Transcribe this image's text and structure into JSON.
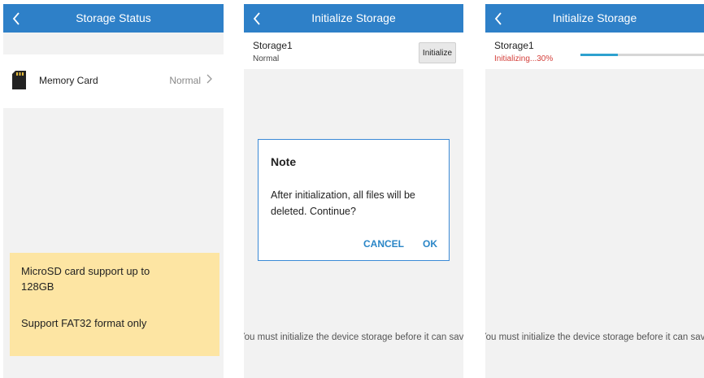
{
  "screen1": {
    "title": "Storage Status",
    "memory_card": {
      "label": "Memory Card",
      "status": "Normal"
    },
    "note": {
      "line1": "MicroSD card support up to 128GB",
      "line2": "Support FAT32 format only"
    }
  },
  "screen2": {
    "title": "Initialize Storage",
    "storage": {
      "name": "Storage1",
      "status": "Normal"
    },
    "initialize_label": "Initialize",
    "dialog": {
      "title": "Note",
      "body": "After initialization, all files will be deleted. Continue?",
      "cancel_label": "CANCEL",
      "ok_label": "OK"
    },
    "footer": "You must initialize the device storage before it can save videos."
  },
  "screen3": {
    "title": "Initialize Storage",
    "storage": {
      "name": "Storage1",
      "status": "Initializing...30%",
      "progress_percent": 30
    },
    "footer": "You must initialize the device storage before it can save videos."
  },
  "colors": {
    "header": "#2e80c8",
    "accent": "#2a86c7",
    "progress": "#2ea1cf",
    "error": "#d43f3a",
    "note_bg": "#fde5a3"
  },
  "icons": {
    "back": "chevron-left-icon",
    "forward": "chevron-right-icon",
    "memory_card": "sd-card-icon"
  }
}
